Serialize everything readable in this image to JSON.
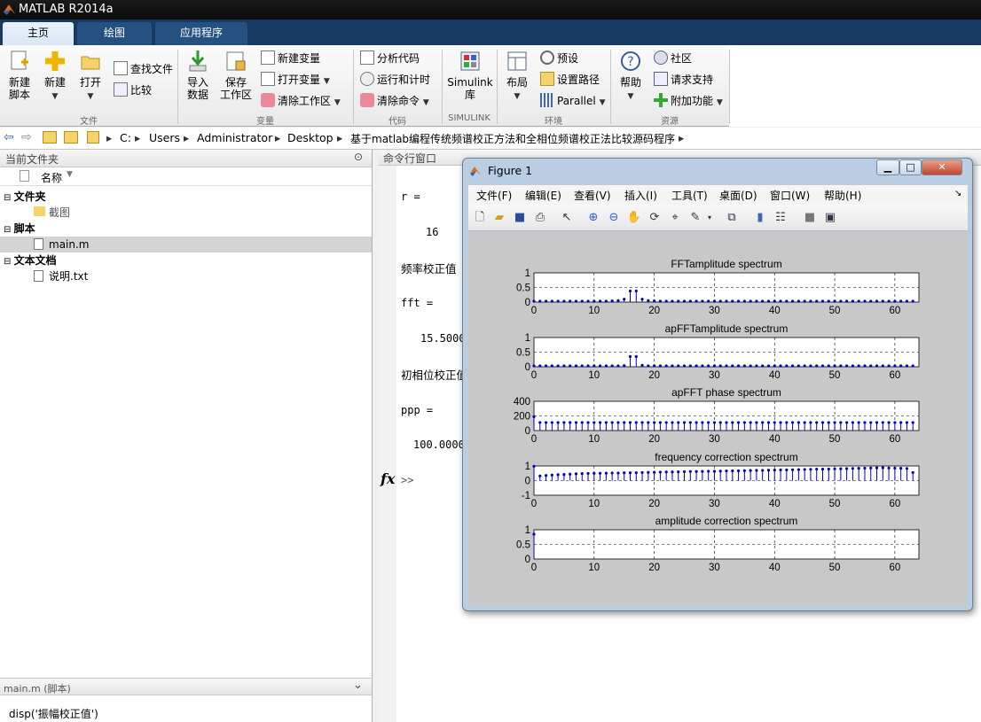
{
  "app": {
    "title": "MATLAB R2014a"
  },
  "tabs": [
    "主页",
    "绘图",
    "应用程序"
  ],
  "ribbon": {
    "new_script": "新建\n脚本",
    "new": "新建",
    "open": "打开",
    "find_files": "查找文件",
    "compare": "比较",
    "import_data": "导入\n数据",
    "save_workspace": "保存\n工作区",
    "new_variable": "新建变量",
    "open_variable": "打开变量",
    "clear_workspace": "清除工作区",
    "analyze_code": "分析代码",
    "run_and_time": "运行和计时",
    "clear_commands": "清除命令",
    "simulink_library": "Simulink\n库",
    "layout": "布局",
    "preferences": "预设",
    "set_path": "设置路径",
    "parallel": "Parallel",
    "help": "帮助",
    "community": "社区",
    "request_support": "请求支持",
    "add_ons": "附加功能",
    "groups": [
      "文件",
      "变量",
      "代码",
      "SIMULINK",
      "环境",
      "资源"
    ]
  },
  "path": [
    "C:",
    "Users",
    "Administrator",
    "Desktop",
    "基于matlab编程传统频谱校正方法和全相位频谱校正法比较源码程序"
  ],
  "file_panel": {
    "title": "当前文件夹",
    "name_col": "名称",
    "sections": [
      {
        "label": "文件夹",
        "items": [
          "截图"
        ]
      },
      {
        "label": "脚本",
        "items": [
          "main.m"
        ]
      },
      {
        "label": "文本文档",
        "items": [
          "说明.txt"
        ]
      }
    ],
    "details_title": "main.m (脚本)",
    "details_content": "disp('振幅校正值')"
  },
  "command_window": {
    "title": "命令行窗口",
    "lines": [
      {
        "text": "r ="
      },
      {
        "text": "16"
      },
      {
        "text": "频率校正值"
      },
      {
        "text": "fft ="
      },
      {
        "text": "15.5000"
      },
      {
        "text": "初相位校正值"
      },
      {
        "text": "ppp ="
      },
      {
        "text": "100.0000"
      }
    ],
    "prompt": ">>",
    "fx": "fx"
  },
  "figure": {
    "title": "Figure 1",
    "menu": [
      "文件(F)",
      "编辑(E)",
      "查看(V)",
      "插入(I)",
      "工具(T)",
      "桌面(D)",
      "窗口(W)",
      "帮助(H)"
    ]
  },
  "chart_data": [
    {
      "type": "stem",
      "title": "FFTamplitude spectrum",
      "xlim": [
        0,
        64
      ],
      "ylim": [
        0,
        1
      ],
      "yticks": [
        "1",
        "0.5",
        "0"
      ],
      "xticks": [
        "0",
        "10",
        "20",
        "30",
        "40",
        "50",
        "60"
      ],
      "grid": true,
      "values": [
        0.03,
        0.03,
        0.03,
        0.03,
        0.03,
        0.03,
        0.03,
        0.03,
        0.03,
        0.03,
        0.03,
        0.03,
        0.03,
        0.04,
        0.05,
        0.1,
        0.38,
        0.38,
        0.1,
        0.05,
        0.04,
        0.03,
        0.03,
        0.03,
        0.03,
        0.03,
        0.03,
        0.03,
        0.03,
        0.03,
        0.03,
        0.03,
        0.03,
        0.03,
        0.03,
        0.03,
        0.03,
        0.03,
        0.03,
        0.03,
        0.03,
        0.03,
        0.03,
        0.03,
        0.03,
        0.03,
        0.03,
        0.03,
        0.03,
        0.03,
        0.03,
        0.03,
        0.03,
        0.03,
        0.03,
        0.03,
        0.03,
        0.03,
        0.03,
        0.03,
        0.03,
        0.03,
        0.03,
        0.03
      ]
    },
    {
      "type": "stem",
      "title": "apFFTamplitude spectrum",
      "xlim": [
        0,
        64
      ],
      "ylim": [
        0,
        1
      ],
      "yticks": [
        "1",
        "0.5",
        "0"
      ],
      "xticks": [
        "0",
        "10",
        "20",
        "30",
        "40",
        "50",
        "60"
      ],
      "grid": true,
      "values": [
        0.03,
        0.03,
        0.03,
        0.03,
        0.03,
        0.03,
        0.03,
        0.03,
        0.03,
        0.03,
        0.03,
        0.03,
        0.03,
        0.03,
        0.03,
        0.04,
        0.35,
        0.35,
        0.05,
        0.03,
        0.03,
        0.03,
        0.03,
        0.03,
        0.03,
        0.03,
        0.03,
        0.03,
        0.03,
        0.03,
        0.03,
        0.03,
        0.03,
        0.03,
        0.03,
        0.03,
        0.03,
        0.03,
        0.03,
        0.03,
        0.03,
        0.03,
        0.03,
        0.03,
        0.03,
        0.03,
        0.03,
        0.03,
        0.03,
        0.03,
        0.03,
        0.03,
        0.03,
        0.03,
        0.03,
        0.03,
        0.03,
        0.03,
        0.03,
        0.03,
        0.03,
        0.03,
        0.03,
        0.03
      ]
    },
    {
      "type": "stem",
      "title": "apFFT phase spectrum",
      "xlim": [
        0,
        64
      ],
      "ylim": [
        0,
        400
      ],
      "yticks": [
        "400",
        "200",
        "0"
      ],
      "xticks": [
        "0",
        "10",
        "20",
        "30",
        "40",
        "50",
        "60"
      ],
      "grid": true,
      "values": [
        190,
        110,
        110,
        110,
        110,
        110,
        110,
        110,
        110,
        110,
        110,
        110,
        110,
        110,
        110,
        110,
        110,
        110,
        110,
        110,
        110,
        110,
        110,
        110,
        110,
        110,
        110,
        110,
        110,
        110,
        110,
        110,
        110,
        110,
        110,
        110,
        110,
        110,
        110,
        110,
        110,
        110,
        110,
        110,
        110,
        110,
        110,
        110,
        110,
        110,
        110,
        110,
        110,
        110,
        110,
        110,
        110,
        110,
        110,
        110,
        110,
        110,
        110,
        110
      ]
    },
    {
      "type": "stem",
      "title": "frequency correction spectrum",
      "xlim": [
        0,
        64
      ],
      "ylim": [
        -1,
        1
      ],
      "yticks": [
        "1",
        "0",
        "-1"
      ],
      "xticks": [
        "0",
        "10",
        "20",
        "30",
        "40",
        "50",
        "60"
      ],
      "grid": true,
      "values": [
        0.98,
        0.32,
        0.35,
        0.38,
        0.4,
        0.42,
        0.44,
        0.46,
        0.48,
        0.49,
        0.5,
        0.5,
        0.51,
        0.52,
        0.52,
        0.53,
        0.53,
        0.54,
        0.55,
        0.56,
        0.57,
        0.58,
        0.59,
        0.59,
        0.6,
        0.61,
        0.62,
        0.62,
        0.63,
        0.64,
        0.64,
        0.65,
        0.66,
        0.67,
        0.67,
        0.68,
        0.69,
        0.7,
        0.7,
        0.71,
        0.72,
        0.73,
        0.73,
        0.74,
        0.75,
        0.76,
        0.77,
        0.78,
        0.78,
        0.79,
        0.8,
        0.81,
        0.82,
        0.83,
        0.84,
        0.85,
        0.86,
        0.87,
        0.88,
        0.86,
        0.85,
        0.84,
        0.83,
        0.55
      ]
    },
    {
      "type": "stem",
      "title": "amplitude correction spectrum",
      "xlim": [
        0,
        64
      ],
      "ylim": [
        0,
        1
      ],
      "yticks": [
        "1",
        "0.5",
        "0"
      ],
      "xticks": [
        "0",
        "10",
        "20",
        "30",
        "40",
        "50",
        "60"
      ],
      "grid": true,
      "values": [
        0.85
      ]
    }
  ]
}
